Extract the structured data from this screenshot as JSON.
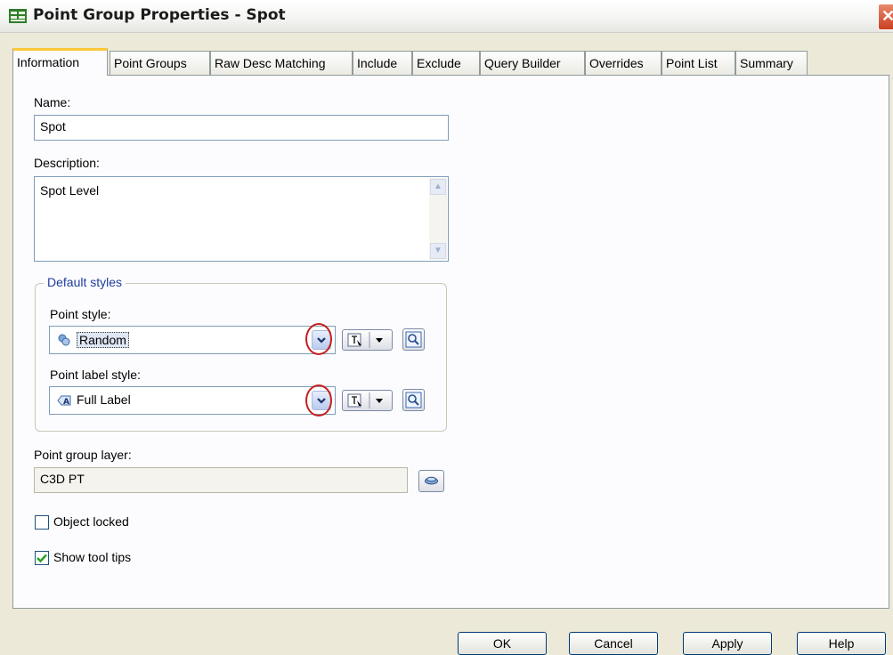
{
  "window": {
    "title": "Point Group Properties - Spot"
  },
  "tabs": [
    {
      "label": "Information",
      "active": true
    },
    {
      "label": "Point Groups"
    },
    {
      "label": "Raw Desc Matching"
    },
    {
      "label": "Include"
    },
    {
      "label": "Exclude"
    },
    {
      "label": "Query Builder"
    },
    {
      "label": "Overrides"
    },
    {
      "label": "Point List"
    },
    {
      "label": "Summary"
    }
  ],
  "information": {
    "name_label": "Name:",
    "name_value": "Spot",
    "description_label": "Description:",
    "description_value": "Spot Level",
    "default_styles": {
      "legend": "Default styles",
      "point_style_label": "Point style:",
      "point_style_value": "Random",
      "point_label_style_label": "Point label style:",
      "point_label_style_value": "Full Label"
    },
    "layer_label": "Point group layer:",
    "layer_value": "C3D PT",
    "object_locked": {
      "label": "Object locked",
      "checked": false
    },
    "show_tool_tips": {
      "label": "Show tool tips",
      "checked": true
    }
  },
  "buttons": {
    "ok": "OK",
    "cancel": "Cancel",
    "apply": "Apply",
    "help": "Help"
  },
  "colors": {
    "accent_tab": "#ffc83c",
    "group_legend": "#1f3c9e",
    "highlight_ring": "#c81e1e"
  },
  "icons": [
    "app-icon",
    "close-icon",
    "scroll-up-icon",
    "scroll-down-icon",
    "point-style-icon",
    "label-style-icon",
    "chevron-down-icon",
    "style-edit-icon",
    "magnify-icon",
    "layer-select-icon",
    "checkmark-icon"
  ]
}
